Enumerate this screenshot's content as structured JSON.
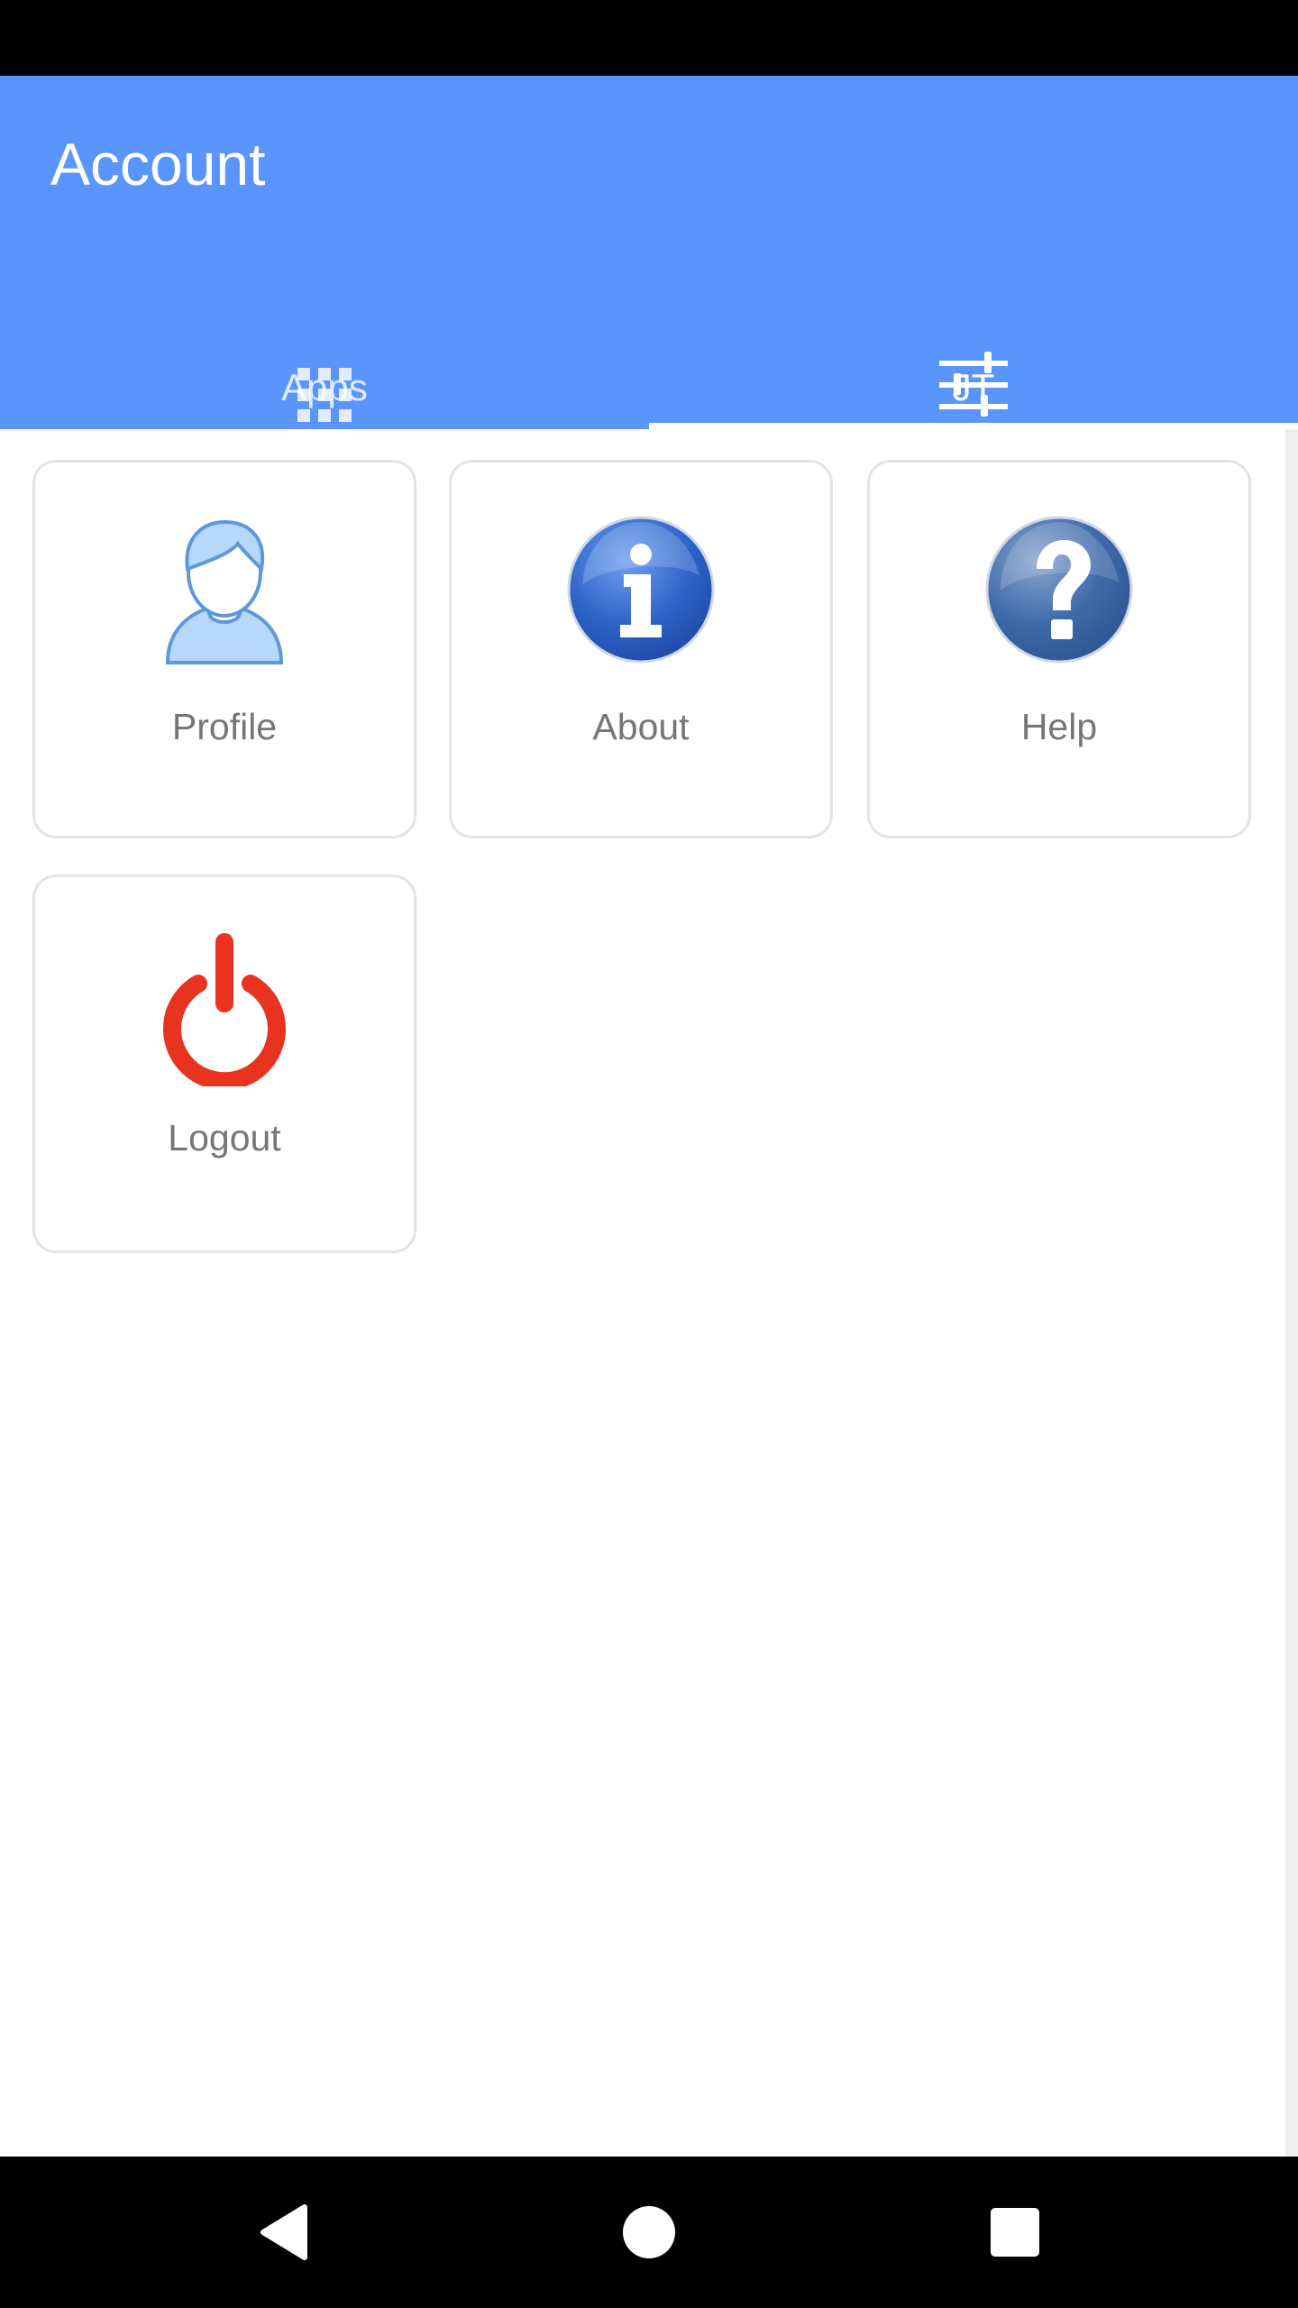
{
  "app_bar": {
    "title": "Account",
    "background_color": "#5a95fe"
  },
  "tabs": [
    {
      "label": "Apps",
      "icon": "grid-icon",
      "selected": false
    },
    {
      "label": "JT",
      "icon": "sliders-icon",
      "selected": true
    }
  ],
  "cards": [
    {
      "label": "Profile",
      "icon": "person-icon"
    },
    {
      "label": "About",
      "icon": "info-icon"
    },
    {
      "label": "Help",
      "icon": "help-icon"
    },
    {
      "label": "Logout",
      "icon": "power-icon",
      "icon_color": "#e8331e"
    }
  ],
  "nav_bar": {
    "buttons": [
      "back-icon",
      "home-icon",
      "recents-icon"
    ]
  }
}
